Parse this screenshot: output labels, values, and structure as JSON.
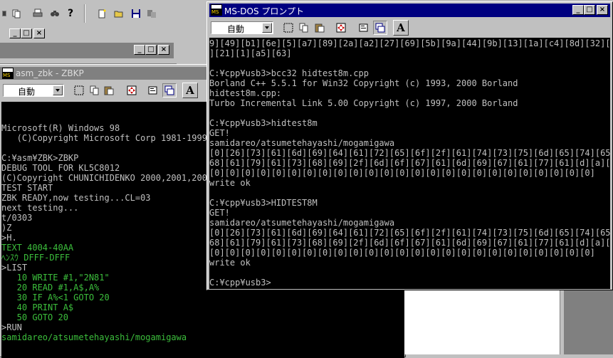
{
  "dos_window": {
    "title": "MS-DOS プロンプト",
    "font_size_value": "自動",
    "font_button_label": "A",
    "lines": [
      "9][49][b1][6e][5][a7][89][2a][a2][27][69][5b][9a][44][9b][13][1a][c4][8d][32][56",
      "][21][1][a5][63]",
      "",
      "C:¥cpp¥usb3>bcc32 hidtest8m.cpp",
      "Borland C++ 5.5.1 for Win32 Copyright (c) 1993, 2000 Borland",
      "hidtest8m.cpp:",
      "Turbo Incremental Link 5.00 Copyright (c) 1997, 2000 Borland",
      "",
      "C:¥cpp¥usb3>hidtest8m",
      "GET!",
      "samidareo/atsumetehayashi/mogamigawa",
      "[0][26][73][61][6d][69][64][61][72][65][6f][2f][61][74][73][75][6d][65][74][65][",
      "68][61][79][61][73][68][69][2f][6d][6f][67][61][6d][69][67][61][77][61][d][a][0]",
      "[0][0][0][0][0][0][0][0][0][0][0][0][0][0][0][0][0][0][0][0][0][0][0][0][0]",
      "write ok",
      "",
      "C:¥cpp¥usb3>HIDTEST8M",
      "GET!",
      "samidareo/atsumetehayashi/mogamigawa",
      "[0][26][73][61][6d][69][64][61][72][65][6f][2f][61][74][73][75][6d][65][74][65][",
      "68][61][79][61][73][68][69][2f][6d][6f][67][61][6d][69][67][61][77][61][d][a][0]",
      "[0][0][0][0][0][0][0][0][0][0][0][0][0][0][0][0][0][0][0][0][0][0][0][0][0]",
      "write ok",
      "",
      "C:¥cpp¥usb3>"
    ]
  },
  "zbk_window": {
    "title": "asm_zbk - ZBKP",
    "font_size_value": "自動",
    "font_button_label": "A",
    "lines": [
      {
        "text": "",
        "color": "gray"
      },
      {
        "text": "",
        "color": "gray"
      },
      {
        "text": "Microsoft(R) Windows 98",
        "color": "gray"
      },
      {
        "text": "   (C)Copyright Microsoft Corp 1981-1999.",
        "color": "gray"
      },
      {
        "text": "",
        "color": "gray"
      },
      {
        "text": "C:¥asm¥ZBK>ZBKP",
        "color": "gray"
      },
      {
        "text": "DEBUG TOOL FOR KL5C8012",
        "color": "gray"
      },
      {
        "text": "(C)Copyright CHUNICHIDENKO 2000,2001,2004",
        "color": "gray"
      },
      {
        "text": "TEST START",
        "color": "gray"
      },
      {
        "text": "ZBK READY,now testing...CL=03",
        "color": "gray"
      },
      {
        "text": "next testing...",
        "color": "gray"
      },
      {
        "text": "t/0303",
        "color": "gray"
      },
      {
        "text": ")Z",
        "color": "gray"
      },
      {
        "text": ">H.",
        "color": "gray"
      },
      {
        "text": "TEXT 4004-40AA",
        "color": "green"
      },
      {
        "text": "ﾍﾝｽｳ DFFF-DFFF",
        "color": "green"
      },
      {
        "text": ">LIST",
        "color": "gray"
      },
      {
        "text": "   10 WRITE #1,\"2N81\"",
        "color": "green"
      },
      {
        "text": "   20 READ #1,A$,A%",
        "color": "green"
      },
      {
        "text": "   30 IF A%<1 GOTO 20",
        "color": "green"
      },
      {
        "text": "   40 PRINT A$",
        "color": "green"
      },
      {
        "text": "   50 GOTO 20",
        "color": "green"
      },
      {
        "text": ">RUN",
        "color": "gray"
      },
      {
        "text": "samidareo/atsumetehayashi/mogamigawa",
        "color": "green"
      }
    ]
  },
  "caption_buttons": {
    "minimize": "_",
    "maximize": "□",
    "close": "×"
  },
  "top_toolbar_icons": [
    "cut-icon",
    "copy-icon",
    "print-icon",
    "find-icon",
    "help-icon",
    "new-icon",
    "open-icon",
    "save-icon",
    "merge-icon"
  ],
  "colors": {
    "title_active": "#000080",
    "title_inactive": "#808080",
    "console_bg": "#000000",
    "console_text": "#c0c0c0",
    "console_green": "#3cbf3c",
    "face": "#c0c0c0"
  }
}
